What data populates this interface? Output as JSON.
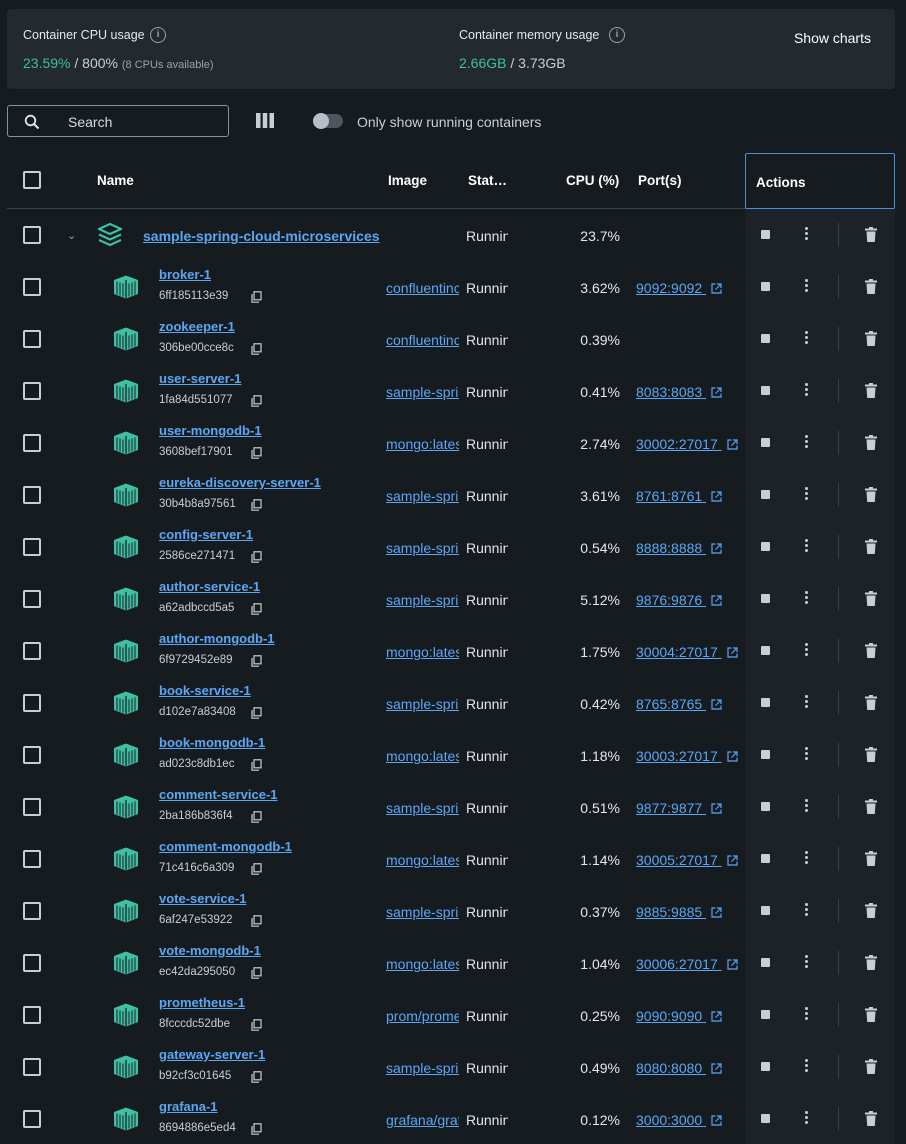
{
  "stats": {
    "cpu_label": "Container CPU usage",
    "cpu_used": "23.59%",
    "cpu_total": " / 800%",
    "cpu_note": "(8 CPUs available)",
    "mem_label": "Container memory usage",
    "mem_used": "2.66GB",
    "mem_total": " / 3.73GB",
    "show_charts": "Show charts"
  },
  "toolbar": {
    "search_placeholder": "Search",
    "toggle_label": "Only show running containers",
    "toggle_on": false
  },
  "table": {
    "headers": {
      "name": "Name",
      "image": "Image",
      "status": "Stat…",
      "cpu": "CPU (%)",
      "ports": "Port(s)",
      "actions": "Actions"
    },
    "group": {
      "name": "sample-spring-cloud-microservices",
      "status": "Running",
      "cpu": "23.7%"
    },
    "containers": [
      {
        "name": "broker-1",
        "id": "6ff185113e39",
        "image": "confluentinc",
        "status": "Running",
        "cpu": "3.62%",
        "port": "9092:9092"
      },
      {
        "name": "zookeeper-1",
        "id": "306be00cce8c",
        "image": "confluentinc",
        "status": "Running",
        "cpu": "0.39%",
        "port": ""
      },
      {
        "name": "user-server-1",
        "id": "1fa84d551077",
        "image": "sample-spring",
        "status": "Running",
        "cpu": "0.41%",
        "port": "8083:8083"
      },
      {
        "name": "user-mongodb-1",
        "id": "3608bef17901",
        "image": "mongo:latest",
        "status": "Running",
        "cpu": "2.74%",
        "port": "30002:27017"
      },
      {
        "name": "eureka-discovery-server-1",
        "id": "30b4b8a97561",
        "image": "sample-spring",
        "status": "Running",
        "cpu": "3.61%",
        "port": "8761:8761"
      },
      {
        "name": "config-server-1",
        "id": "2586ce271471",
        "image": "sample-spring",
        "status": "Running",
        "cpu": "0.54%",
        "port": "8888:8888"
      },
      {
        "name": "author-service-1",
        "id": "a62adbccd5a5",
        "image": "sample-spring",
        "status": "Running",
        "cpu": "5.12%",
        "port": "9876:9876"
      },
      {
        "name": "author-mongodb-1",
        "id": "6f9729452e89",
        "image": "mongo:latest",
        "status": "Running",
        "cpu": "1.75%",
        "port": "30004:27017"
      },
      {
        "name": "book-service-1",
        "id": "d102e7a83408",
        "image": "sample-spring",
        "status": "Running",
        "cpu": "0.42%",
        "port": "8765:8765"
      },
      {
        "name": "book-mongodb-1",
        "id": "ad023c8db1ec",
        "image": "mongo:latest",
        "status": "Running",
        "cpu": "1.18%",
        "port": "30003:27017"
      },
      {
        "name": "comment-service-1",
        "id": "2ba186b836f4",
        "image": "sample-spring",
        "status": "Running",
        "cpu": "0.51%",
        "port": "9877:9877"
      },
      {
        "name": "comment-mongodb-1",
        "id": "71c416c6a309",
        "image": "mongo:latest",
        "status": "Running",
        "cpu": "1.14%",
        "port": "30005:27017"
      },
      {
        "name": "vote-service-1",
        "id": "6af247e53922",
        "image": "sample-spring",
        "status": "Running",
        "cpu": "0.37%",
        "port": "9885:9885"
      },
      {
        "name": "vote-mongodb-1",
        "id": "ec42da295050",
        "image": "mongo:latest",
        "status": "Running",
        "cpu": "1.04%",
        "port": "30006:27017"
      },
      {
        "name": "prometheus-1",
        "id": "8fcccdc52dbe",
        "image": "prom/prometheus",
        "status": "Running",
        "cpu": "0.25%",
        "port": "9090:9090"
      },
      {
        "name": "gateway-server-1",
        "id": "b92cf3c01645",
        "image": "sample-spring",
        "status": "Running",
        "cpu": "0.49%",
        "port": "8080:8080"
      },
      {
        "name": "grafana-1",
        "id": "8694886e5ed4",
        "image": "grafana/grafana",
        "status": "Running",
        "cpu": "0.12%",
        "port": "3000:3000"
      }
    ]
  },
  "colors": {
    "accent_green": "#3fbfa3",
    "link_blue": "#5ba7f5",
    "background": "#161b20",
    "card": "#22292f"
  }
}
